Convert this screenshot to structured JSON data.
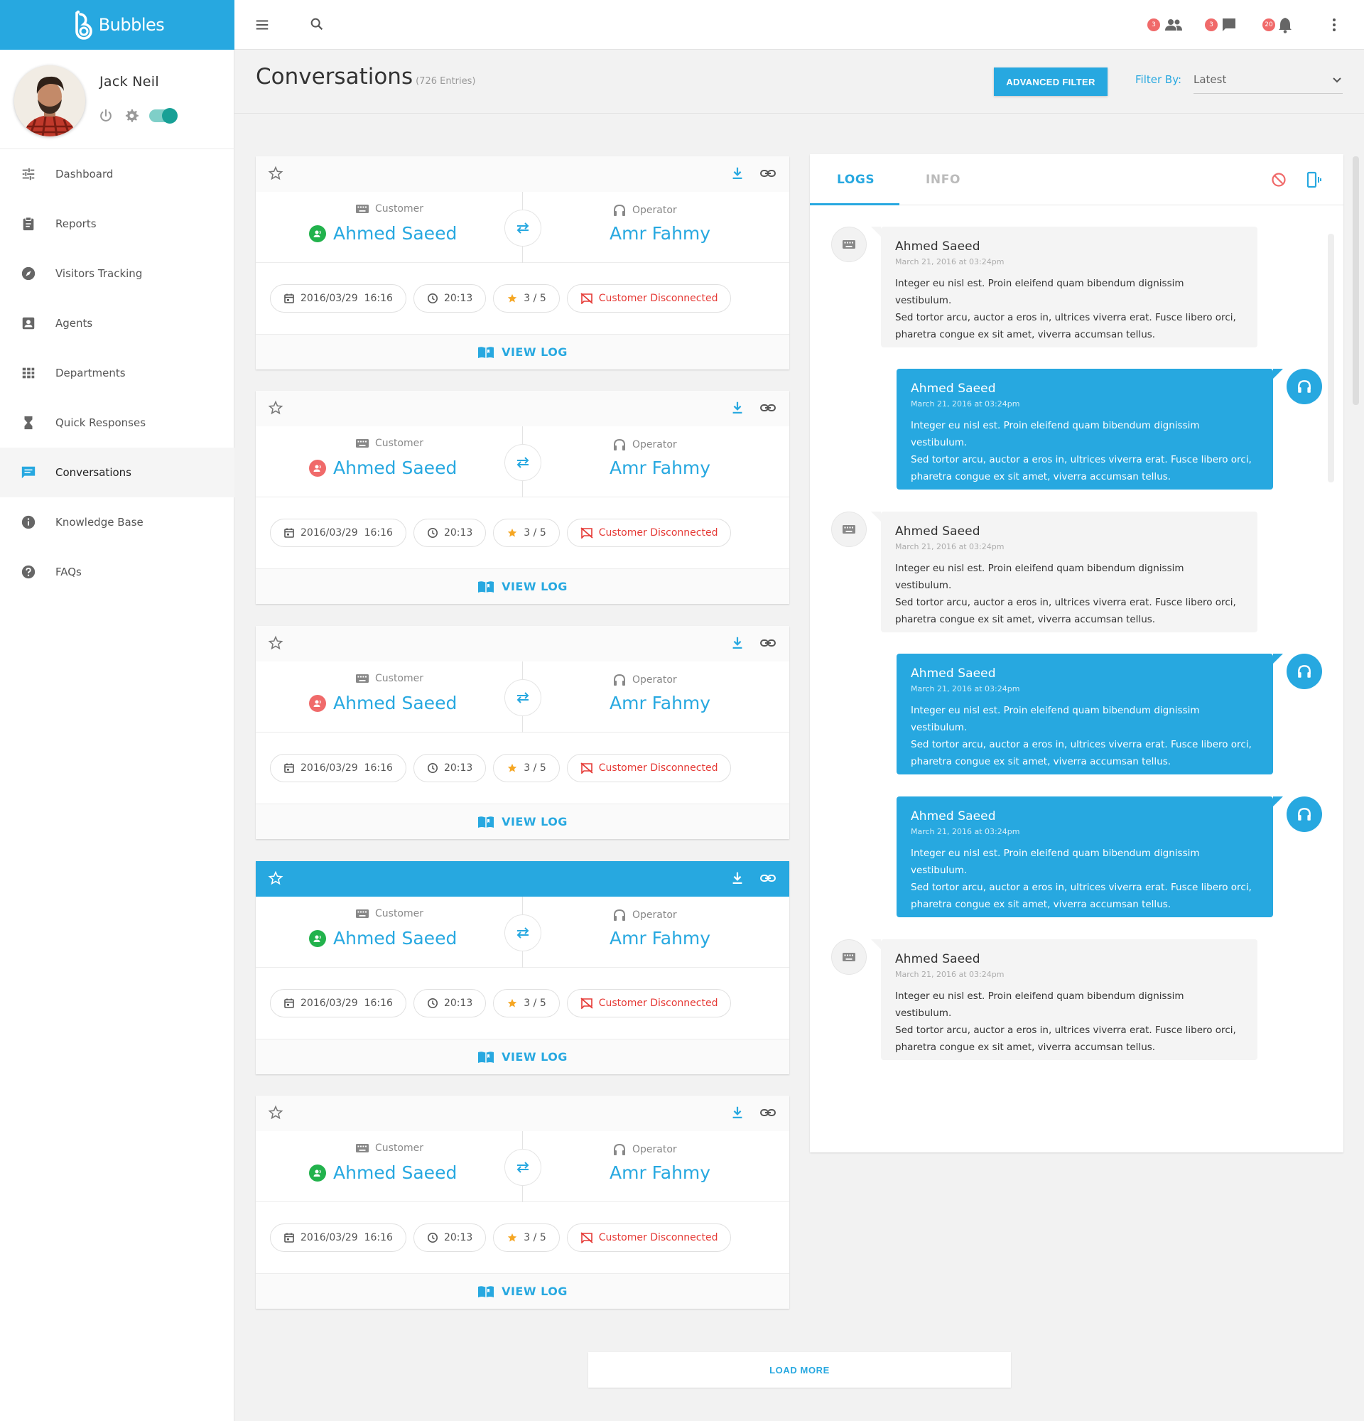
{
  "brand": {
    "name": "Bubbles"
  },
  "user": {
    "name": "Jack Neil"
  },
  "menu": [
    {
      "label": "Dashboard",
      "icon": "sliders-icon"
    },
    {
      "label": "Reports",
      "icon": "clipboard-icon"
    },
    {
      "label": "Visitors Tracking",
      "icon": "compass-icon"
    },
    {
      "label": "Agents",
      "icon": "agent-icon"
    },
    {
      "label": "Departments",
      "icon": "grid-icon"
    },
    {
      "label": "Quick Responses",
      "icon": "hourglass-icon"
    },
    {
      "label": "Conversations",
      "icon": "chat-icon",
      "active": true
    },
    {
      "label": "Knowledge Base",
      "icon": "info-icon"
    },
    {
      "label": "FAQs",
      "icon": "help-icon"
    }
  ],
  "topbar": {
    "badges": {
      "users": "3",
      "messages": "3",
      "notifications": "20"
    }
  },
  "page": {
    "title": "Conversations",
    "count": "(726 Entries)",
    "advanced_filter": "ADVANCED FILTER",
    "filter_label": "Filter By:",
    "filter_value": "Latest",
    "load_more": "LOAD MORE"
  },
  "conversations": [
    {
      "customer_label": "Customer",
      "customer": "Ahmed Saeed",
      "customer_status": "online",
      "operator_label": "Operator",
      "operator": "Amr Fahmy",
      "date": "2016/03/29  16:16",
      "duration": "20:13",
      "rating": "3 / 5",
      "status": "Customer Disconnected",
      "view_log": "VIEW LOG",
      "highlighted": false
    },
    {
      "customer_label": "Customer",
      "customer": "Ahmed Saeed",
      "customer_status": "offline",
      "operator_label": "Operator",
      "operator": "Amr Fahmy",
      "date": "2016/03/29  16:16",
      "duration": "20:13",
      "rating": "3 / 5",
      "status": "Customer Disconnected",
      "view_log": "VIEW LOG",
      "highlighted": false
    },
    {
      "customer_label": "Customer",
      "customer": "Ahmed Saeed",
      "customer_status": "offline",
      "operator_label": "Operator",
      "operator": "Amr Fahmy",
      "date": "2016/03/29  16:16",
      "duration": "20:13",
      "rating": "3 / 5",
      "status": "Customer Disconnected",
      "view_log": "VIEW LOG",
      "highlighted": false
    },
    {
      "customer_label": "Customer",
      "customer": "Ahmed Saeed",
      "customer_status": "online",
      "operator_label": "Operator",
      "operator": "Amr Fahmy",
      "date": "2016/03/29  16:16",
      "duration": "20:13",
      "rating": "3 / 5",
      "status": "Customer Disconnected",
      "view_log": "VIEW LOG",
      "highlighted": true
    },
    {
      "customer_label": "Customer",
      "customer": "Ahmed Saeed",
      "customer_status": "online",
      "operator_label": "Operator",
      "operator": "Amr Fahmy",
      "date": "2016/03/29  16:16",
      "duration": "20:13",
      "rating": "3 / 5",
      "status": "Customer Disconnected",
      "view_log": "VIEW LOG",
      "highlighted": false
    }
  ],
  "logs": {
    "tabs": [
      "LOGS",
      "INFO"
    ],
    "messages": [
      {
        "side": "customer",
        "name": "Ahmed Saeed",
        "date": "March 21, 2016 at 03:24pm",
        "lines": [
          "Integer eu nisl est. Proin eleifend quam bibendum dignissim vestibulum.",
          "Sed tortor arcu, auctor a eros in, ultrices viverra erat. Fusce libero orci,",
          "pharetra congue ex sit amet, viverra accumsan tellus."
        ]
      },
      {
        "side": "operator",
        "name": "Ahmed Saeed",
        "date": "March 21, 2016 at 03:24pm",
        "lines": [
          "Integer eu nisl est. Proin eleifend quam bibendum dignissim vestibulum.",
          "Sed tortor arcu, auctor a eros in, ultrices viverra erat. Fusce libero orci,",
          "pharetra congue ex sit amet, viverra accumsan tellus."
        ]
      },
      {
        "side": "customer",
        "name": "Ahmed Saeed",
        "date": "March 21, 2016 at 03:24pm",
        "lines": [
          "Integer eu nisl est. Proin eleifend quam bibendum dignissim vestibulum.",
          "Sed tortor arcu, auctor a eros in, ultrices viverra erat. Fusce libero orci,",
          "pharetra congue ex sit amet, viverra accumsan tellus."
        ]
      },
      {
        "side": "operator",
        "name": "Ahmed Saeed",
        "date": "March 21, 2016 at 03:24pm",
        "lines": [
          "Integer eu nisl est. Proin eleifend quam bibendum dignissim vestibulum.",
          "Sed tortor arcu, auctor a eros in, ultrices viverra erat. Fusce libero orci,",
          "pharetra congue ex sit amet, viverra accumsan tellus."
        ]
      },
      {
        "side": "operator",
        "name": "Ahmed Saeed",
        "date": "March 21, 2016 at 03:24pm",
        "lines": [
          "Integer eu nisl est. Proin eleifend quam bibendum dignissim vestibulum.",
          "Sed tortor arcu, auctor a eros in, ultrices viverra erat. Fusce libero orci,",
          "pharetra congue ex sit amet, viverra accumsan tellus."
        ]
      },
      {
        "side": "customer",
        "name": "Ahmed Saeed",
        "date": "March 21, 2016 at 03:24pm",
        "lines": [
          "Integer eu nisl est. Proin eleifend quam bibendum dignissim vestibulum.",
          "Sed tortor arcu, auctor a eros in, ultrices viverra erat. Fusce libero orci,",
          "pharetra congue ex sit amet, viverra accumsan tellus."
        ]
      }
    ]
  },
  "colors": {
    "accent": "#27a8e0",
    "online": "#22b24c",
    "offline": "#f06a6a",
    "danger": "#e53935",
    "star": "#f5a623",
    "toggle": "#17a096"
  }
}
